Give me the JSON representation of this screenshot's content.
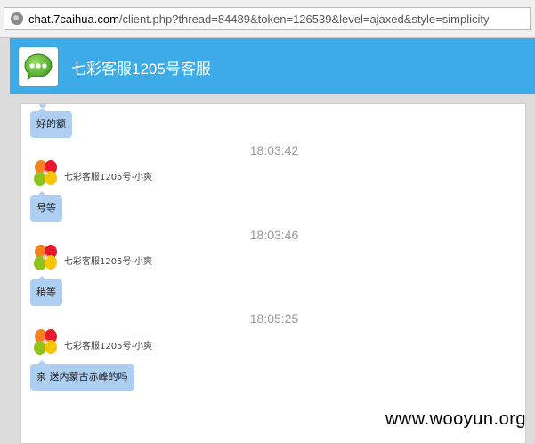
{
  "browser": {
    "url_host": "chat.7caihua.com",
    "url_path": "/client.php?thread=84489&token=126539&level=ajaxed&style=simplicity"
  },
  "header": {
    "title": "七彩客服1205号客服",
    "icon": "chat-bubble-icon"
  },
  "messages": [
    {
      "type": "user",
      "text": "好的额"
    },
    {
      "type": "time",
      "text": "18:03:42"
    },
    {
      "type": "agent_name",
      "text": "七彩客服1205号-小爽"
    },
    {
      "type": "agent",
      "text": "号等"
    },
    {
      "type": "time",
      "text": "18:03:46"
    },
    {
      "type": "agent_name",
      "text": "七彩客服1205号-小爽"
    },
    {
      "type": "agent",
      "text": "稍等"
    },
    {
      "type": "time",
      "text": "18:05:25"
    },
    {
      "type": "agent_name",
      "text": "七彩客服1205号-小爽"
    },
    {
      "type": "agent",
      "text": "亲 送内蒙古赤峰的吗"
    }
  ],
  "watermark": "www.wooyun.org",
  "colors": {
    "header": "#3cabe8",
    "bubble": "#aecff2",
    "timestamp": "#9a9a9a"
  }
}
